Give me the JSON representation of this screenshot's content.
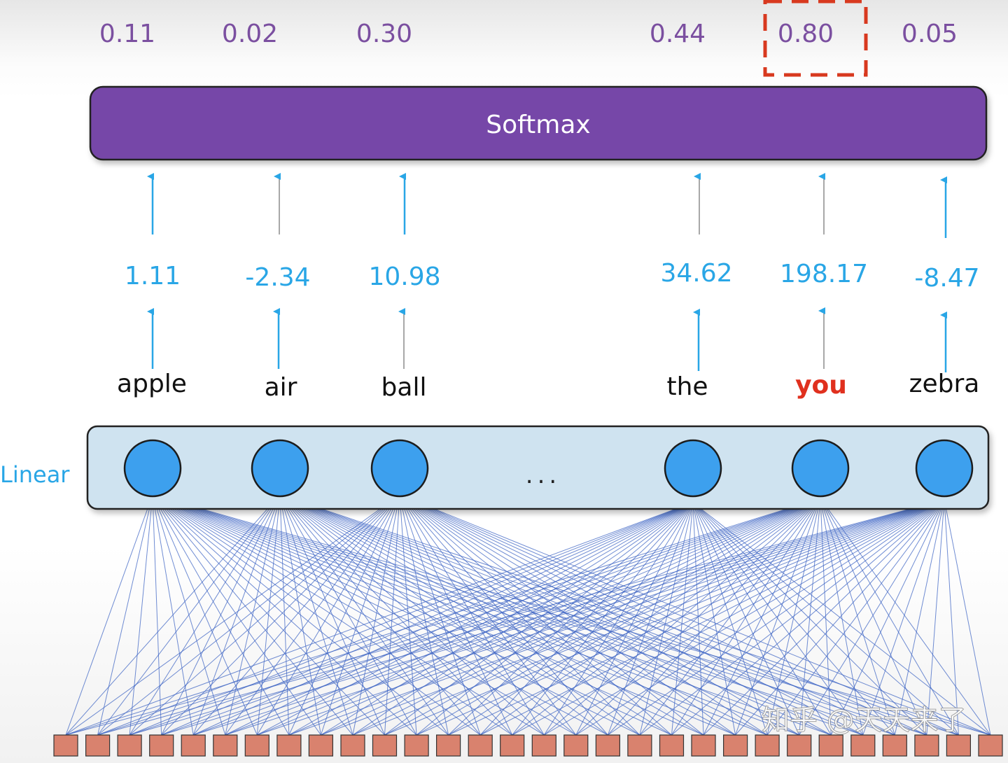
{
  "softmax": {
    "label": "Softmax",
    "color": "#7647A8"
  },
  "linear": {
    "label": "Linear",
    "fill": "#CFE3F0",
    "neuron_color": "#3DA0EE"
  },
  "ellipsis": "...",
  "outputs": [
    {
      "word": "apple",
      "logit": "1.11",
      "prob": "0.11",
      "highlighted": false
    },
    {
      "word": "air",
      "logit": "-2.34",
      "prob": "0.02",
      "highlighted": false
    },
    {
      "word": "ball",
      "logit": "10.98",
      "prob": "0.30",
      "highlighted": false
    },
    {
      "word": "the",
      "logit": "34.62",
      "prob": "0.44",
      "highlighted": false
    },
    {
      "word": "you",
      "logit": "198.17",
      "prob": "0.80",
      "highlighted": true
    },
    {
      "word": "zebra",
      "logit": "-8.47",
      "prob": "0.05",
      "highlighted": false
    }
  ],
  "input_units_count": 30,
  "colors": {
    "prob_text": "#7B4FA0",
    "logit_text": "#29A6E6",
    "highlight": "#E0301E",
    "connection": "#3F66C4",
    "input_unit": "#D9826E"
  },
  "watermark": "知乎 @天天来了"
}
